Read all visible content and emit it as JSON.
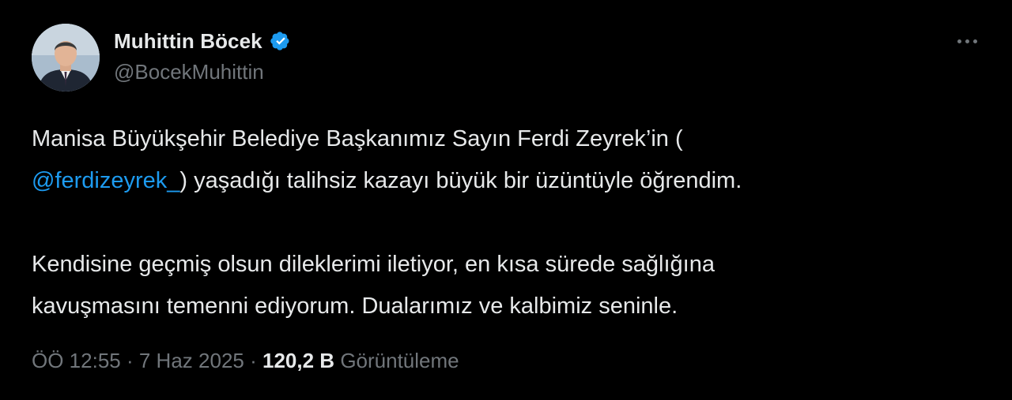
{
  "author": {
    "display_name": "Muhittin Böcek",
    "handle": "@BocekMuhittin",
    "verified_icon": "verified-badge-icon",
    "avatar_icon": "avatar"
  },
  "menu": {
    "more_icon": "more-horizontal-icon"
  },
  "tweet": {
    "line1": "Manisa Büyükşehir Belediye Başkanımız Sayın Ferdi Zeyrek’in (",
    "mention": "@ferdizeyrek_",
    "line2_rest": ") yaşadığı talihsiz kazayı büyük bir üzüntüyle öğrendim.",
    "line3": "Kendisine geçmiş olsun dileklerimi iletiyor, en kısa sürede sağlığına",
    "line4": "kavuşmasını temenni ediyorum. Dualarımız ve kalbimiz seninle."
  },
  "meta": {
    "time": "ÖÖ 12:55",
    "separator": "·",
    "date": "7 Haz 2025",
    "views_count": "120,2 B",
    "views_label": "Görüntüleme"
  },
  "colors": {
    "background": "#000000",
    "text": "#e7e9ea",
    "secondary": "#71767b",
    "accent": "#1d9bf0"
  }
}
